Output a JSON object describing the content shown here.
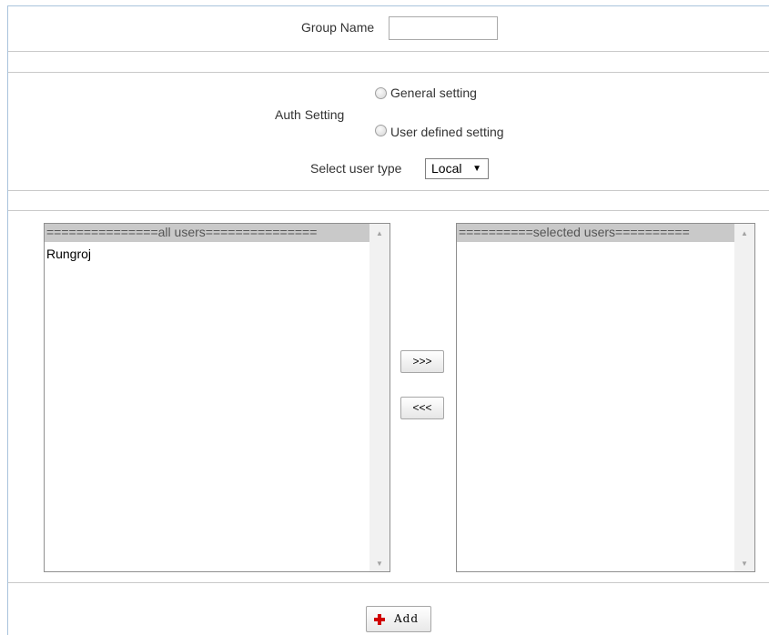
{
  "form": {
    "group_name_label": "Group Name",
    "group_name_value": "",
    "auth_setting_label": "Auth Setting",
    "auth_options": [
      {
        "label": "General setting",
        "selected": false
      },
      {
        "label": "User defined setting",
        "selected": false
      }
    ],
    "user_type_label": "Select user type",
    "user_type_value": "Local"
  },
  "lists": {
    "all_users_header": "===============all users===============",
    "all_users": [
      "Rungroj"
    ],
    "selected_users_header": "==========selected users==========",
    "selected_users": []
  },
  "buttons": {
    "move_right": ">>>",
    "move_left": "<<<",
    "add": "Add"
  },
  "colors": {
    "frame_border": "#a9c3dc",
    "list_header_bg": "#c9c9c9",
    "add_icon": "#d00000"
  }
}
